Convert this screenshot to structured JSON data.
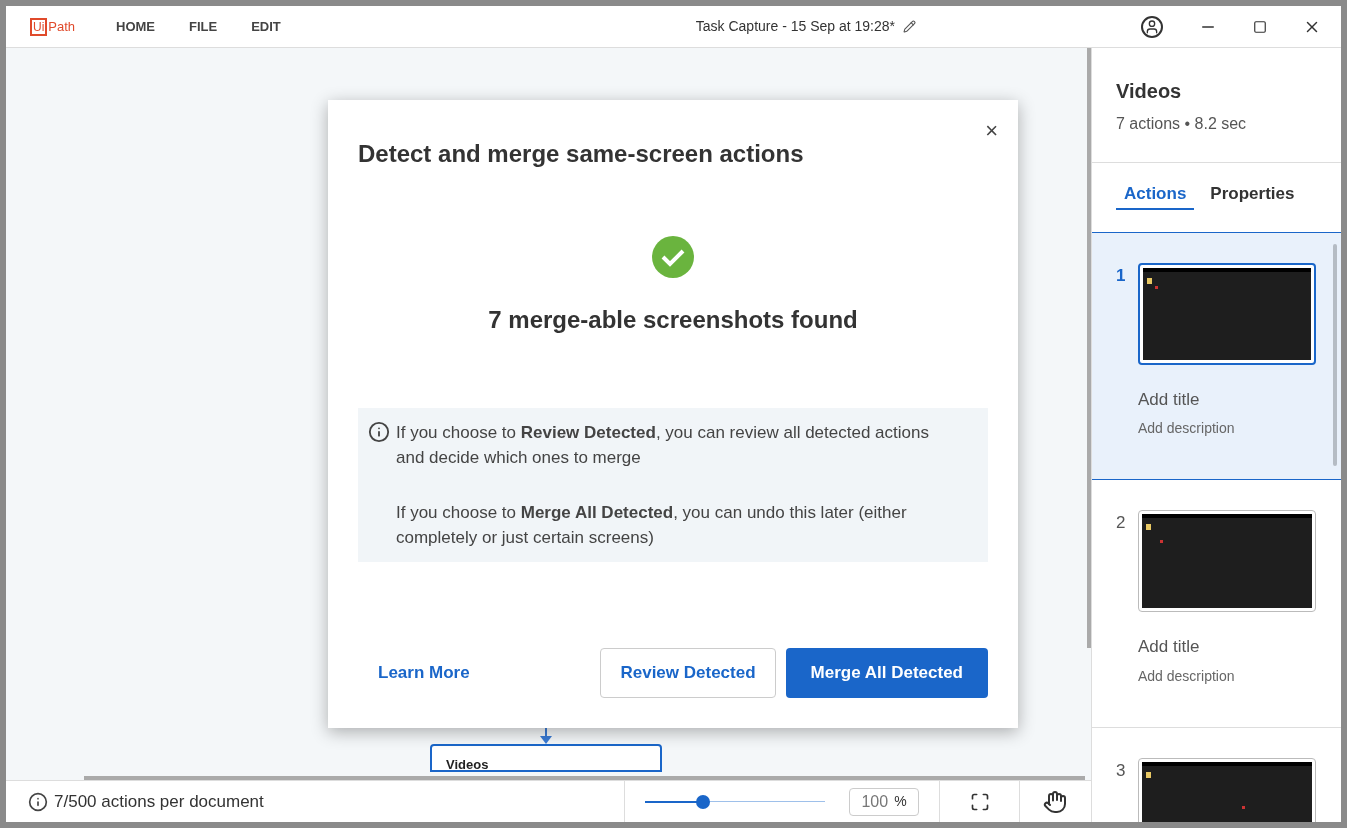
{
  "app": {
    "logo_box": "Ui",
    "logo_text": "Path"
  },
  "menu": [
    "HOME",
    "FILE",
    "EDIT"
  ],
  "window": {
    "title": "Task Capture - 15 Sep at 19:28*"
  },
  "canvas": {
    "node_label": "Videos"
  },
  "dialog": {
    "title": "Detect and merge same-screen actions",
    "result": "7 merge-able screenshots found",
    "close": "×",
    "info": [
      "If you choose to **Review Detected**, you can review all detected actions and decide which ones to merge",
      "If you choose to **Merge All Detected**, you can undo this later (either completely or just certain screens)"
    ],
    "link": "Learn More",
    "secondary": "Review Detected",
    "primary": "Merge All Detected"
  },
  "panel": {
    "title": "Videos",
    "subtitle": "7 actions • 8.2 sec",
    "tabs": [
      {
        "label": "Actions",
        "selected": true
      },
      {
        "label": "Properties",
        "selected": false
      }
    ],
    "actions": [
      {
        "number": "1",
        "selected": true,
        "title": "Add title",
        "description": "Add description"
      },
      {
        "number": "2",
        "selected": false,
        "title": "Add title",
        "description": "Add description"
      },
      {
        "number": "3",
        "selected": false
      }
    ]
  },
  "status_bar": {
    "text": "7/500 actions per document",
    "zoom": {
      "level": 0.32
    },
    "zoom_value": "100",
    "zoom_unit": "%"
  }
}
